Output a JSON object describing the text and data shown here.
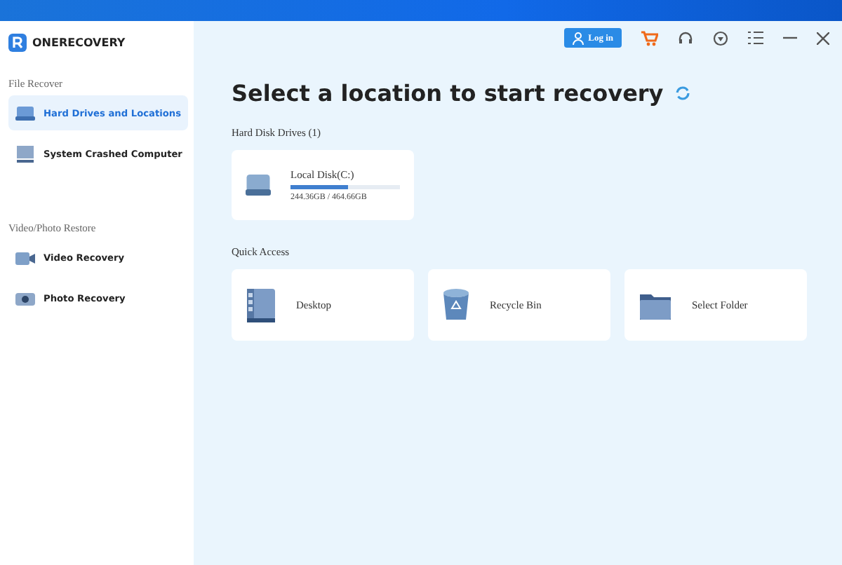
{
  "app": {
    "name": "ONERECOVERY"
  },
  "toolbar": {
    "login": "Log in"
  },
  "sidebar": {
    "sections": [
      {
        "title": "File Recover",
        "items": [
          {
            "label": "Hard Drives and Locations",
            "kind": "drive",
            "selected": true
          },
          {
            "label": "System Crashed Computer",
            "kind": "monitor",
            "selected": false
          }
        ]
      },
      {
        "title": "Video/Photo Restore",
        "items": [
          {
            "label": "Video Recovery",
            "kind": "video",
            "selected": false
          },
          {
            "label": "Photo Recovery",
            "kind": "camera",
            "selected": false
          }
        ]
      }
    ]
  },
  "main": {
    "heading": "Select a location to start recovery",
    "drives_title": "Hard Disk Drives (1)",
    "drives": [
      {
        "name": "Local Disk(C:)",
        "level": 0.53,
        "usage": "244.36GB / 464.66GB"
      }
    ],
    "quick_title": "Quick Access",
    "quick": [
      {
        "label": "Desktop",
        "kind": "desktop"
      },
      {
        "label": "Recycle Bin",
        "kind": "bin"
      },
      {
        "label": "Select Folder",
        "kind": "folder"
      }
    ]
  }
}
